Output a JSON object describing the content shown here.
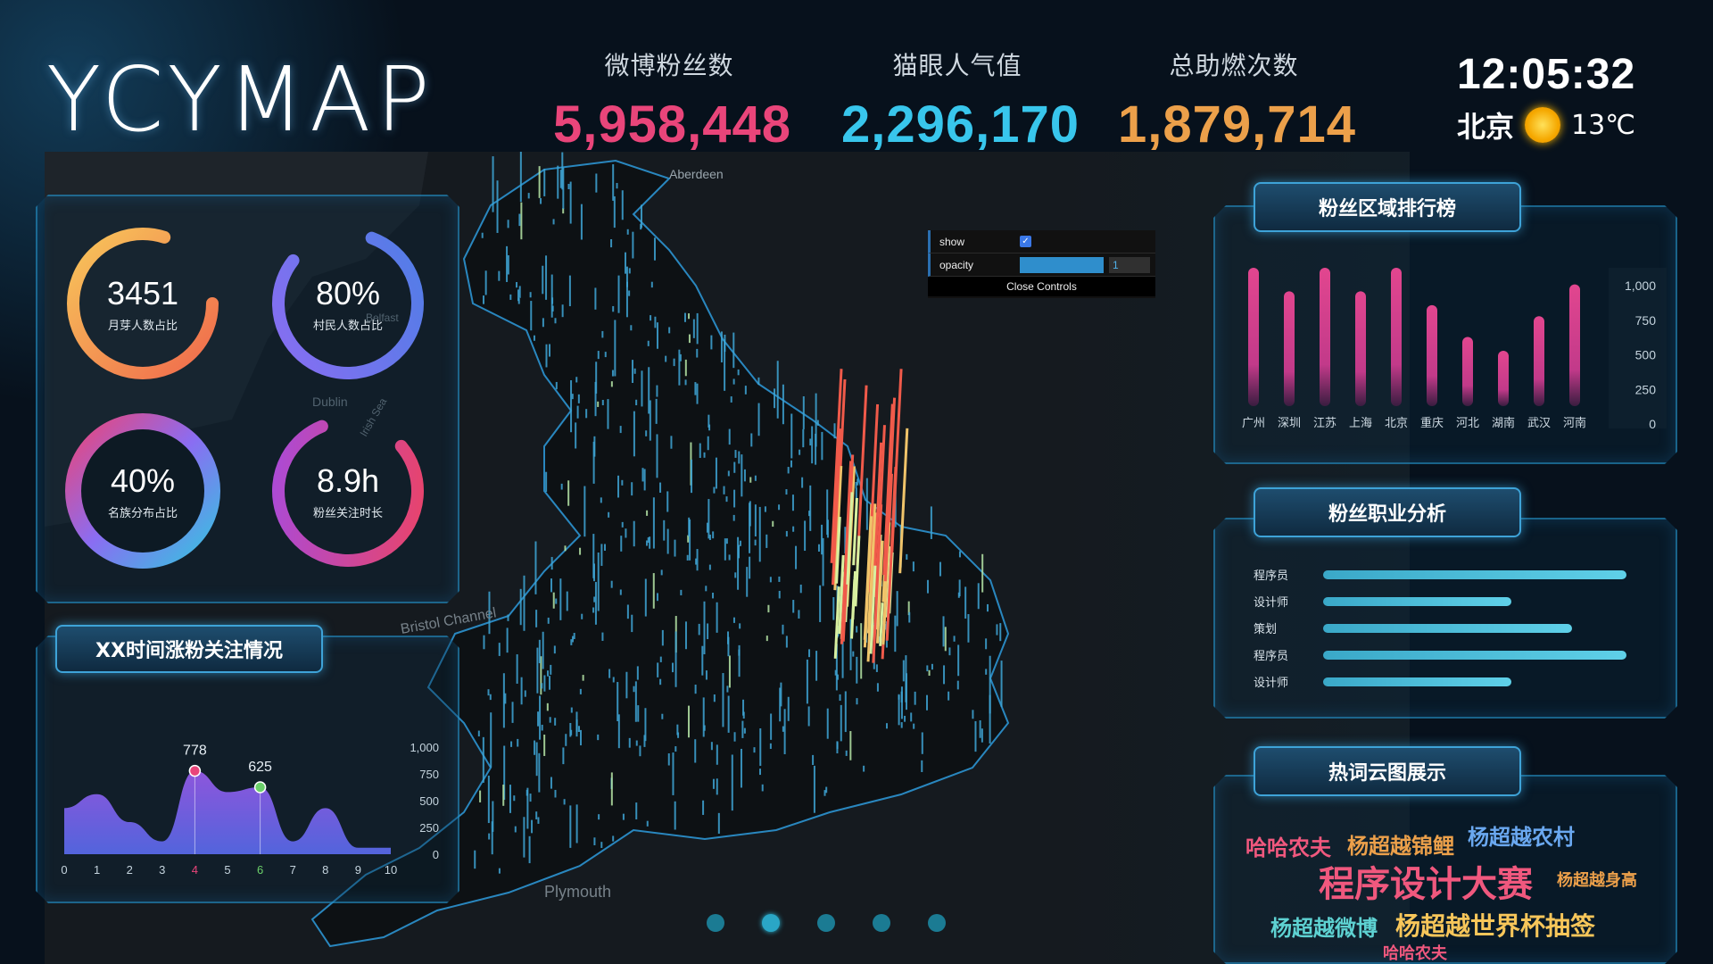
{
  "logo": "YCYMAP",
  "stats": [
    {
      "label": "微博粉丝数",
      "value": "5,958,448",
      "color": "#e9457a"
    },
    {
      "label": "猫眼人气值",
      "value": "2,296,170",
      "color": "#38c6ec"
    },
    {
      "label": "总助燃次数",
      "value": "1,879,714",
      "color": "#eca04a"
    }
  ],
  "clock": {
    "time": "12:05:32",
    "city": "北京",
    "temp": "13℃",
    "icon": "sun-icon"
  },
  "rings": [
    {
      "value": "3451",
      "caption": "月芽人数占比",
      "percent": 0.8,
      "color_start": "#f7c65a",
      "color_end": "#f0694c"
    },
    {
      "value": "80%",
      "caption": "村民人数占比",
      "percent": 0.8,
      "color_start": "#8a6df2",
      "color_end": "#4f7ee6"
    },
    {
      "value": "40%",
      "caption": "名族分布占比",
      "percent": 1.0,
      "color_start": "#e9457a",
      "color_end": "#37c2e0"
    },
    {
      "value": "8.9h",
      "caption": "粉丝关注时长",
      "percent": 0.8,
      "color_start": "#a34be4",
      "color_end": "#f0435e"
    }
  ],
  "controls": {
    "show_label": "show",
    "show_checked": true,
    "opacity_label": "opacity",
    "opacity_value": "1",
    "close_label": "Close Controls"
  },
  "trend_panel": {
    "title": "XX时间涨粉关注情况",
    "chart_data": {
      "type": "area",
      "x": [
        0,
        1,
        2,
        3,
        4,
        5,
        6,
        7,
        8,
        9,
        10
      ],
      "values": [
        430,
        560,
        300,
        120,
        778,
        580,
        625,
        120,
        430,
        60,
        60
      ],
      "ylim": [
        0,
        1000
      ],
      "yticks": [
        "1,000",
        "750",
        "500",
        "250",
        "0"
      ],
      "annotations": [
        {
          "x": 4,
          "label": "778",
          "color": "#e9457a"
        },
        {
          "x": 6,
          "label": "625",
          "color": "#6bd06a"
        }
      ],
      "grid": false
    }
  },
  "rank_panel": {
    "title": "粉丝区域排行榜",
    "chart_data": {
      "type": "bar",
      "categories": [
        "广州",
        "深圳",
        "江苏",
        "上海",
        "北京",
        "重庆",
        "河北",
        "湖南",
        "武汉",
        "河南"
      ],
      "values": [
        1000,
        830,
        1000,
        830,
        1000,
        730,
        500,
        400,
        650,
        880
      ],
      "ylim": [
        0,
        1000
      ],
      "yticks": [
        "1,000",
        "750",
        "500",
        "250",
        "0"
      ],
      "color": "#e2468f"
    }
  },
  "job_panel": {
    "title": "粉丝职业分析",
    "chart_data": {
      "type": "bar",
      "orientation": "horizontal",
      "categories": [
        "程序员",
        "设计师",
        "策划",
        "程序员",
        "设计师"
      ],
      "values": [
        100,
        62,
        82,
        100,
        62
      ]
    }
  },
  "word_panel": {
    "title": "热词云图展示",
    "words": [
      {
        "text": "哈哈农夫",
        "color": "#f0587e"
      },
      {
        "text": "杨超越锦鲤",
        "color": "#eca04a"
      },
      {
        "text": "杨超越农村",
        "color": "#6aa8f0"
      },
      {
        "text": "程序设计大赛",
        "color": "#f0587e"
      },
      {
        "text": "杨超越身高",
        "color": "#eca04a"
      },
      {
        "text": "杨超越微博",
        "color": "#5ed2d2"
      },
      {
        "text": "杨超越世界杯抽签",
        "color": "#f7c65a"
      },
      {
        "text": "哈哈农夫",
        "color": "#f0587e"
      }
    ]
  },
  "pager": {
    "count": 5,
    "active": 1
  },
  "map_labels": [
    "Aberdeen",
    "Belfast",
    "Dublin",
    "Irish Sea",
    "Bristol Channel",
    "Plymouth"
  ]
}
